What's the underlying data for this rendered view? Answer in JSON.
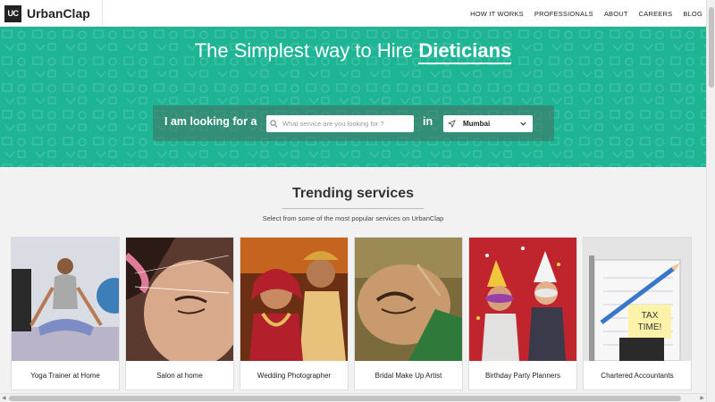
{
  "header": {
    "logo_mark": "UC",
    "logo_text": "UrbanClap",
    "nav": [
      "HOW IT WORKS",
      "PROFESSIONALS",
      "ABOUT",
      "CAREERS",
      "BLOG"
    ]
  },
  "hero": {
    "title_prefix": "The Simplest way to Hire ",
    "title_highlight": "Dieticians",
    "search_label": "I am looking for a",
    "search_placeholder": "What service are you looking for ?",
    "in_label": "in",
    "city": "Mumbai",
    "bg_color": "#1eb595"
  },
  "trending": {
    "title": "Trending services",
    "subtitle": "Select from some of the most popular services on UrbanClap",
    "cards": [
      {
        "label": "Yoga Trainer at Home",
        "icon": "yoga-photo"
      },
      {
        "label": "Salon at home",
        "icon": "salon-photo"
      },
      {
        "label": "Wedding Photographer",
        "icon": "wedding-photo"
      },
      {
        "label": "Bridal Make Up Artist",
        "icon": "makeup-photo"
      },
      {
        "label": "Birthday Party Planners",
        "icon": "birthday-photo"
      },
      {
        "label": "Chartered Accountants",
        "icon": "accountant-photo"
      }
    ]
  },
  "calculator_note": "TAX TIME!"
}
